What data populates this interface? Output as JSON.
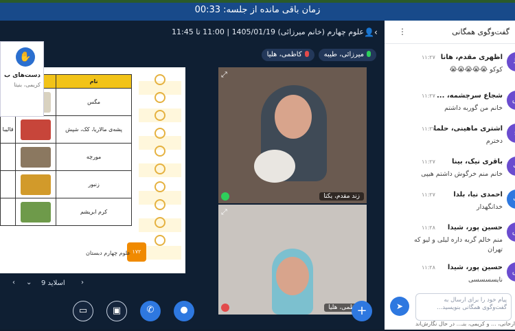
{
  "timer": {
    "text": "زمان باقی مانده از جلسه: 00:33"
  },
  "meeting": {
    "title": "علوم چهارم (خانم میرزائی) 1405/01/19 | 11:00 تا 11:45",
    "chips": [
      {
        "label": "میرزائی، طیبه",
        "mic_color": "#2ecf5b"
      },
      {
        "label": "کاظمی، هلیا",
        "mic_color": "#e24b4b"
      }
    ]
  },
  "raise_hand": {
    "title": "دست‌های ب",
    "subtitle": "کریمی، بنیتا"
  },
  "slide": {
    "header_name": "نام",
    "rows": [
      "مگس",
      "پشه‌ی مالاریا، کک، شپش",
      "مورچه",
      "زنبور",
      "کرم ابریشم"
    ],
    "footer": "علوم چهارم دبستان",
    "badge": "۱۷۲",
    "label_fragment": "قالیبا"
  },
  "slide_nav": {
    "label": "اسلاید 9",
    "next": "‹",
    "prev": "›",
    "drop": "⌄"
  },
  "videos": [
    {
      "name": "زند مقدم، یکتا",
      "mic_color": "#2ecf5b"
    },
    {
      "name": "کاظمی، هلیا",
      "mic_color": "#e24b4b"
    }
  ],
  "chat": {
    "title": "گفت‌وگوی همگانی",
    "messages": [
      {
        "avatar": "ط",
        "name": "اظهری مقدم، هانا",
        "time": "۱۱:۲۷",
        "text": "کوکو 😭😭😭😭😭",
        "text2": "",
        "color": "#6a4ccf"
      },
      {
        "avatar": "ش",
        "name": "شجاع سرچشمه، ...",
        "time": "۱۱:۲۷",
        "text": "خانم من گوربه داشتم",
        "text2": "",
        "color": "#6a4ccf"
      },
      {
        "avatar": "ح",
        "name": "اشتری ماهینی، حلما",
        "time": "۱۱:۲۷",
        "text": "دخترم",
        "text2": "",
        "color": "#6a4ccf"
      },
      {
        "avatar": "ب",
        "name": "باقری نیک، بینا",
        "time": "۱۱:۲۷",
        "text": "خانم منم خرگوش داشتم هیپی",
        "text2": "",
        "color": "#6a4ccf"
      },
      {
        "avatar": "ب",
        "name": "احمدی نیا، بلدا",
        "time": "۱۱:۲۷",
        "text": "خدانگهدار",
        "text2": "",
        "color": "#2e78e0"
      },
      {
        "avatar": "ش",
        "name": "حسین پور، شیدا",
        "time": "۱۱:۲۸",
        "text": "منم خالم گربه داره لیلی و لیو که",
        "text2": "تهران",
        "color": "#6a4ccf"
      },
      {
        "avatar": "ش",
        "name": "حسین پور، شیدا",
        "time": "۱۱:۲۸",
        "text": "نایسسسسی",
        "text2": "",
        "color": "#6a4ccf"
      }
    ],
    "input_placeholder": "پیام خود را برای ارسال به گفت‌وگوی همگانی بنویسید...",
    "typing": "...ارحانی، ... و کریمی، بنـ... در حال نگارش‌اند"
  },
  "controls": {
    "share_icon": "screen-share-off-icon",
    "camera_icon": "camera-off-icon",
    "phone_icon": "phone-icon",
    "mic_icon": "mic-icon",
    "add_icon": "plus-icon"
  },
  "colors": {
    "top_bar": "#184a8a",
    "accent": "#2e78e0",
    "dark_bg": "#0f1f33"
  }
}
